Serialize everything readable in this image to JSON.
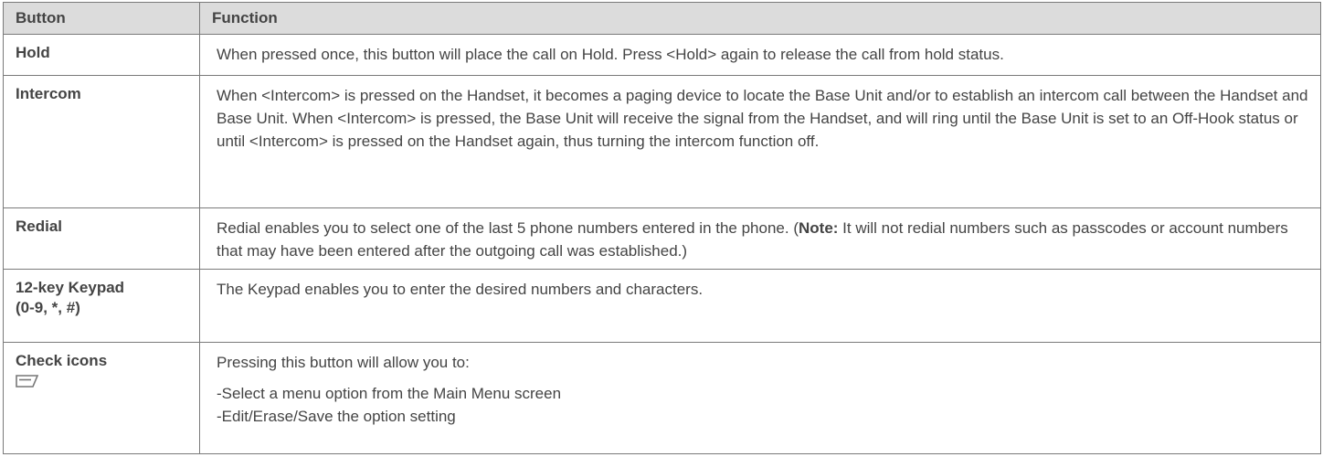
{
  "header": {
    "col_button": "Button",
    "col_function": "Function"
  },
  "rows": [
    {
      "button": "Hold",
      "function": "When pressed once, this button will place the call on Hold. Press <Hold> again to release the call from hold status."
    },
    {
      "button": "Intercom",
      "function": "When <Intercom> is pressed on the Handset, it becomes a paging device to locate the Base Unit and/or to establish an intercom call between the Handset and Base Unit. When <Intercom> is pressed, the Base Unit will receive the signal from the Handset, and will ring until the Base Unit is set to an Off-Hook status or until <Intercom> is pressed on the Handset again, thus turning the intercom function off."
    },
    {
      "button": "Redial",
      "function_before": "Redial enables you to select one of the last 5 phone numbers entered in the phone. (",
      "function_note": "Note:",
      "function_after": " It will not redial numbers such as passcodes or account numbers that may have been entered after the outgoing call was established.)"
    },
    {
      "button_line1": "12-key Keypad",
      "button_line2": "(0-9, *, #)",
      "function": "The Keypad enables you to enter the desired numbers and characters."
    },
    {
      "button": "Check icons",
      "icon": "check-icon",
      "function_intro": "Pressing this button will allow you to:",
      "function_item1": "-Select a menu option from the Main Menu screen",
      "function_item2": "-Edit/Erase/Save the option setting"
    }
  ],
  "colors": {
    "header_bg": "#dcdcdc",
    "border": "#7a7a7a",
    "text": "#444444"
  }
}
